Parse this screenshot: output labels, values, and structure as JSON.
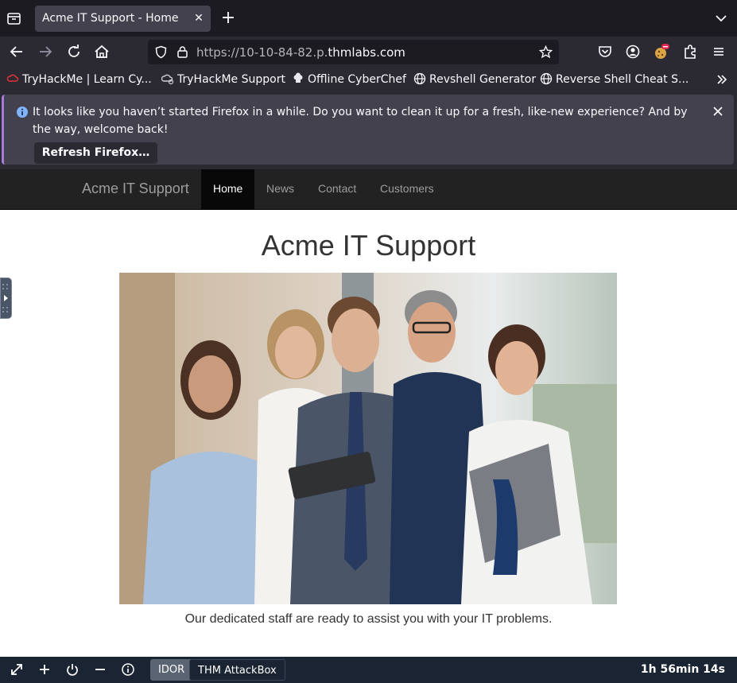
{
  "browser": {
    "tab_title": "Acme IT Support - Home",
    "url_prefix": "https://10-10-84-82.p.",
    "url_domain": "thmlabs.com",
    "bookmarks": [
      {
        "label": "TryHackMe | Learn Cy...",
        "icon": "tryhackme-icon"
      },
      {
        "label": "TryHackMe Support",
        "icon": "support-cloud-icon"
      },
      {
        "label": "Offline CyberChef",
        "icon": "chef-hat-icon"
      },
      {
        "label": "Revshell Generator",
        "icon": "globe-icon"
      },
      {
        "label": "Reverse Shell Cheat S...",
        "icon": "globe-icon"
      }
    ],
    "notification": {
      "message": "It looks like you haven’t started Firefox in a while. Do you want to clean it up for a fresh, like-new experience? And by the way, welcome back!",
      "button": "Refresh Firefox…"
    }
  },
  "site": {
    "brand": "Acme IT Support",
    "nav": [
      {
        "label": "Home",
        "active": true
      },
      {
        "label": "News",
        "active": false
      },
      {
        "label": "Contact",
        "active": false
      },
      {
        "label": "Customers",
        "active": false
      }
    ],
    "title": "Acme IT Support",
    "caption": "Our dedicated staff are ready to assist you with your IT problems."
  },
  "attackbox": {
    "tabs": [
      "IDOR",
      "THM AttackBox"
    ],
    "timer": "1h 56min 14s"
  },
  "colors": {
    "chrome_dark": "#1c1b22",
    "chrome": "#2b2a33",
    "site_nav": "#222222",
    "bottom_bar": "#1b2432"
  }
}
